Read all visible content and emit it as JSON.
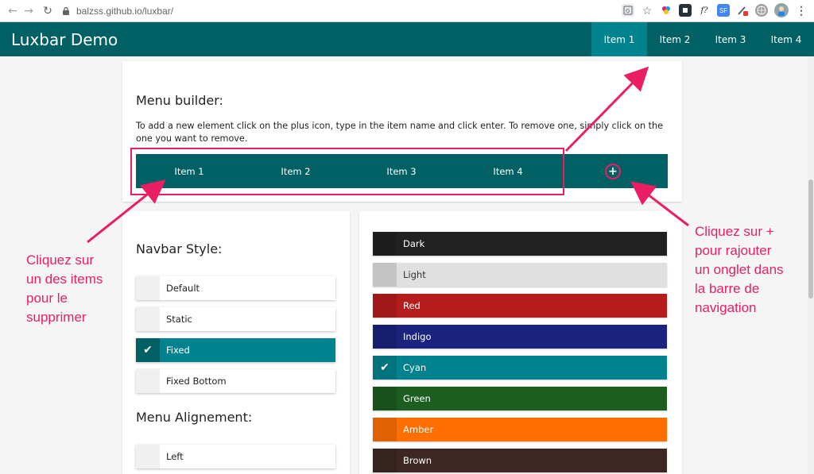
{
  "browser": {
    "url": "balzss.github.io/luxbar/",
    "extensions": [
      "translate-icon",
      "star-icon",
      "color-ext-icon",
      "dark-ext-icon",
      "f-ext-icon",
      "sf-ext-icon",
      "pen-ext-icon",
      "globe-ext-icon",
      "avatar-icon",
      "menu-icon"
    ],
    "ext_f_label": "f?",
    "ext_sf_label": "SF"
  },
  "navbar": {
    "brand": "Luxbar Demo",
    "items": [
      {
        "label": "Item 1",
        "active": true
      },
      {
        "label": "Item 2",
        "active": false
      },
      {
        "label": "Item 3",
        "active": false
      },
      {
        "label": "Item 4",
        "active": false
      }
    ],
    "color": "#006064",
    "active_color": "#00838f"
  },
  "builder": {
    "title": "Menu builder:",
    "description": "To add a new element click on the plus icon, type in the item name and click enter. To remove one, simply click on the one you want to remove.",
    "items": [
      "Item 1",
      "Item 2",
      "Item 3",
      "Item 4"
    ],
    "plus_label": "+"
  },
  "navbar_style": {
    "title": "Navbar Style:",
    "options": [
      {
        "label": "Default",
        "selected": false
      },
      {
        "label": "Static",
        "selected": false
      },
      {
        "label": "Fixed",
        "selected": true
      },
      {
        "label": "Fixed Bottom",
        "selected": false
      }
    ]
  },
  "menu_alignment": {
    "title": "Menu Alignement:",
    "options": [
      {
        "label": "Left",
        "selected": false
      }
    ]
  },
  "colors": [
    {
      "label": "Dark",
      "color": "#212121",
      "selected": false
    },
    {
      "label": "Light",
      "color": "#e0e0e0",
      "selected": false
    },
    {
      "label": "Red",
      "color": "#b71c1c",
      "selected": false
    },
    {
      "label": "Indigo",
      "color": "#1a237e",
      "selected": false
    },
    {
      "label": "Cyan",
      "color": "#00838f",
      "selected": true
    },
    {
      "label": "Green",
      "color": "#1b5e20",
      "selected": false
    },
    {
      "label": "Amber",
      "color": "#ff6f00",
      "selected": false
    },
    {
      "label": "Brown",
      "color": "#3e2723",
      "selected": false
    }
  ],
  "annotations": {
    "left_lines": [
      "Cliquez sur",
      "un des items",
      "pour le",
      "supprimer"
    ],
    "right_lines": [
      "Cliquez sur +",
      "pour rajouter",
      "un onglet dans",
      "la barre de",
      "navigation"
    ],
    "color": "#e91e63"
  },
  "icons": {
    "check": "✔",
    "back": "←",
    "forward": "→",
    "reload": "↻",
    "lock": "🔒"
  }
}
